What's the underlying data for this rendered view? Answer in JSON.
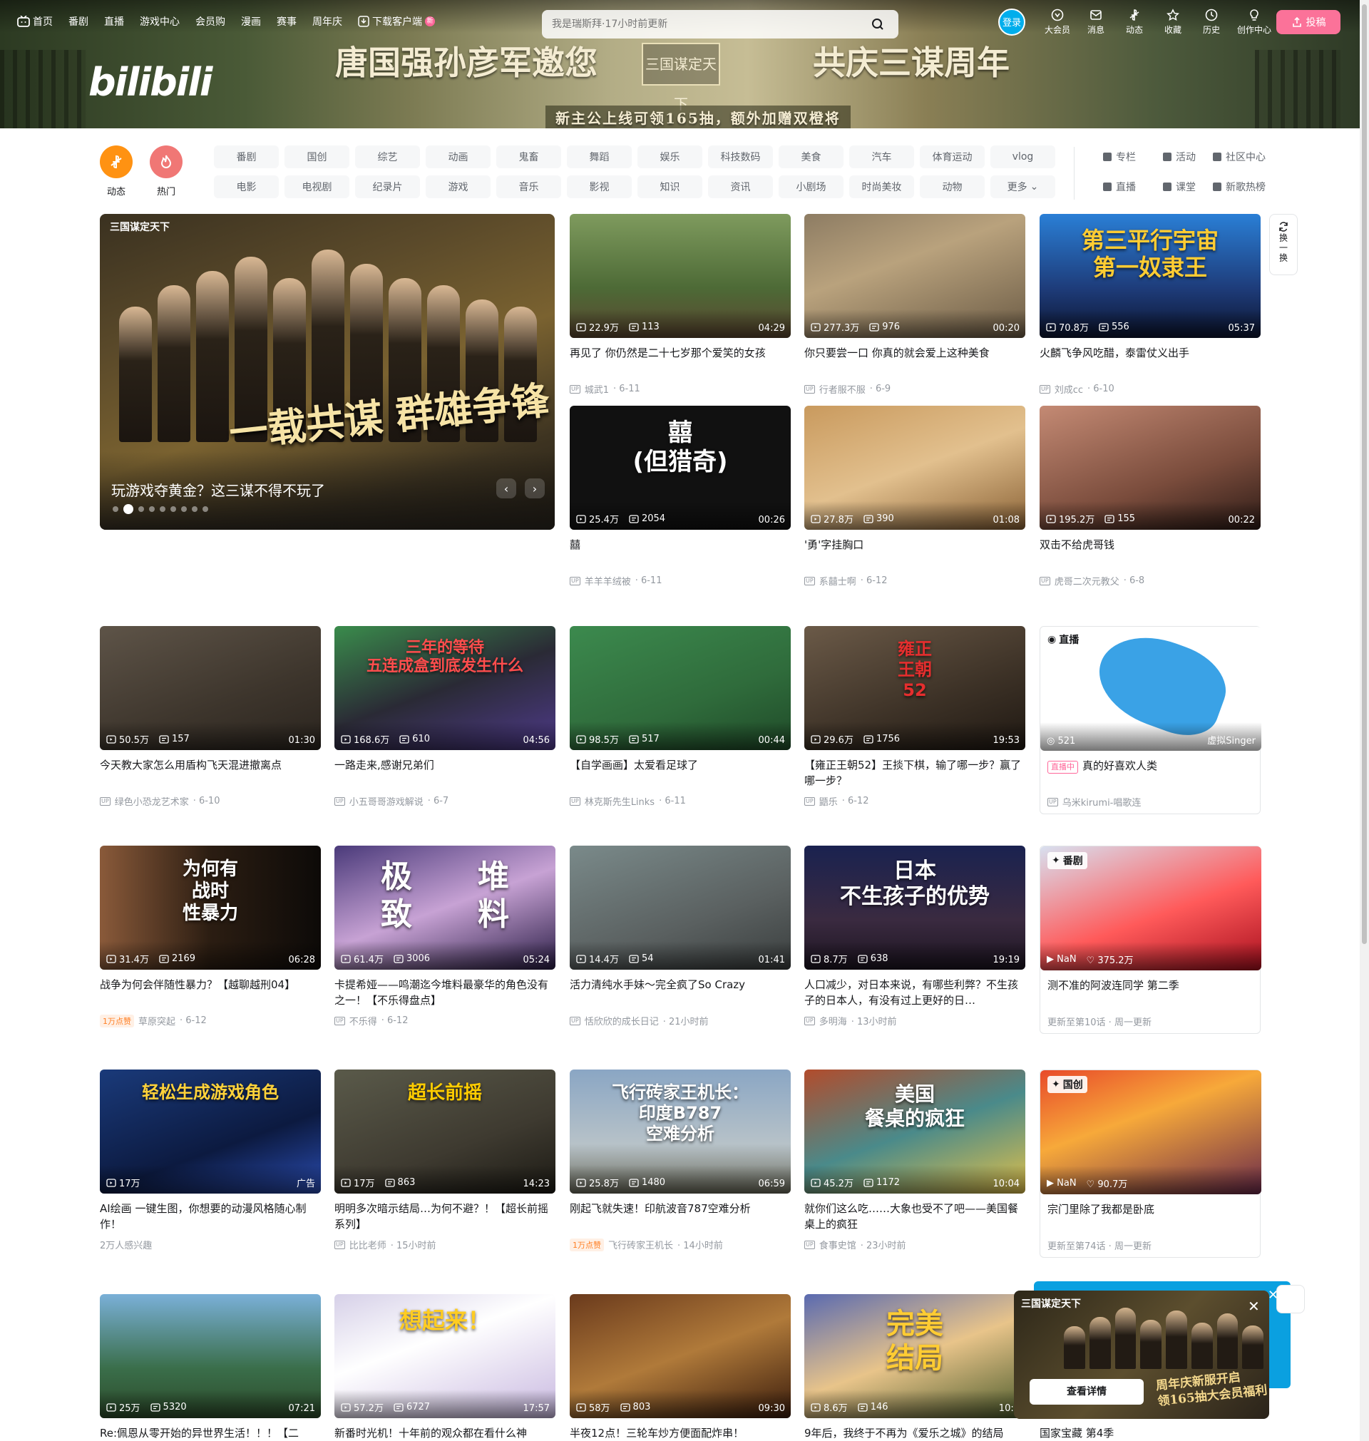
{
  "header": {
    "nav": [
      "首页",
      "番剧",
      "直播",
      "游戏中心",
      "会员购",
      "漫画",
      "赛事",
      "周年庆"
    ],
    "download": "下载客户端",
    "download_badge": "新",
    "search_placeholder": "我是瑞斯拜·17小时前更新",
    "login": "登录",
    "right": [
      "大会员",
      "消息",
      "动态",
      "收藏",
      "历史",
      "创作中心"
    ],
    "upload": "投稿",
    "logo": "bilibili",
    "banner_slogan_left": "唐国强孙彦军邀您",
    "banner_slogan_right": "共庆三谋周年",
    "banner_subline": "新主公上线可领165抽，额外加赠双橙将",
    "banner_game": "三国谋定天下"
  },
  "channels": {
    "big": [
      {
        "label": "动态",
        "color": "#ff9212"
      },
      {
        "label": "热门",
        "color": "#f07775"
      }
    ],
    "chips": [
      "番剧",
      "国创",
      "综艺",
      "动画",
      "鬼畜",
      "舞蹈",
      "娱乐",
      "科技数码",
      "美食",
      "汽车",
      "体育运动",
      "vlog",
      "电影",
      "电视剧",
      "纪录片",
      "游戏",
      "音乐",
      "影视",
      "知识",
      "资讯",
      "小剧场",
      "时尚美妆",
      "动物",
      "更多"
    ],
    "side": [
      "专栏",
      "活动",
      "社区中心",
      "直播",
      "课堂",
      "新歌热榜"
    ]
  },
  "carousel": {
    "title": "玩游戏夺黄金？这三谋不得不玩了",
    "tagline": "一载共谋 群雄争锋",
    "logo": "三国谋定天下",
    "dots": 9,
    "active_dot": 1
  },
  "refresh": "换一换",
  "videos": [
    {
      "title": "再见了 你仍然是二十七岁那个爱笑的女孩",
      "views": "22.9万",
      "danmaku": "113",
      "dur": "04:29",
      "up": "城武1",
      "date": "6-11",
      "bg": "linear-gradient(180deg,#7f9b5e,#4d6a36 60%,#5b4630)"
    },
    {
      "title": "你只要尝一口 你真的就会爱上这种美食",
      "views": "277.3万",
      "danmaku": "976",
      "dur": "00:20",
      "up": "行者服不服",
      "date": "6-9",
      "bg": "linear-gradient(160deg,#8d7c63,#b9a27d 40%,#6b5b45)"
    },
    {
      "title": "火麟飞争风吃醋，泰雷仗义出手",
      "views": "70.8万",
      "danmaku": "556",
      "dur": "05:37",
      "up": "刘成cc",
      "date": "6-10",
      "bg": "linear-gradient(180deg,#2a7fd6,#1e3c7a 60%,#0c1530)",
      "ov": "第三平行宇宙\n第一奴隶王",
      "ovc": "#ffcc33",
      "ovs": "32px"
    },
    {
      "title": "囍",
      "views": "25.4万",
      "danmaku": "2054",
      "dur": "00:26",
      "up": "羊羊羊绒被",
      "date": "6-11",
      "bg": "#111",
      "ov": "囍\n(但猎奇)",
      "ovc": "#fff",
      "ovs": "34px"
    },
    {
      "title": "'勇'字挂胸口",
      "views": "27.8万",
      "danmaku": "390",
      "dur": "01:08",
      "up": "系囍士啊",
      "date": "6-12",
      "bg": "linear-gradient(160deg,#c99a5e,#e2c08e 50%,#8a6236)"
    },
    {
      "title": "双击不给虎哥钱",
      "views": "195.2万",
      "danmaku": "155",
      "dur": "00:22",
      "up": "虎哥二次元教父",
      "date": "6-8",
      "bg": "linear-gradient(160deg,#c48a74,#7a4c3c 60%,#2d1b16)"
    },
    {
      "title": "今天教大家怎么用盾构飞天混进撤离点",
      "views": "50.5万",
      "danmaku": "157",
      "dur": "01:30",
      "up": "绿色小恐龙艺术家",
      "date": "6-10",
      "bg": "linear-gradient(160deg,#5e5448,#3d352c 60%,#2a241e)"
    },
    {
      "title": "一路走来,感谢兄弟们",
      "views": "168.6万",
      "danmaku": "610",
      "dur": "04:56",
      "up": "小五哥哥游戏解说",
      "date": "6-7",
      "bg": "linear-gradient(160deg,#3a8c4c,#2a2a35 50%,#4e3a8a)",
      "ov": "三年的等待\n五连成盒到底发生什么",
      "ovc": "#ff4d4d",
      "ovs": "22px"
    },
    {
      "title": "【自学画画】太爱看足球了",
      "views": "98.5万",
      "danmaku": "517",
      "dur": "00:44",
      "up": "林克斯先生Links",
      "date": "6-11",
      "bg": "linear-gradient(160deg,#3c8a4e,#2f6b3b 60%,#1f4a28)"
    },
    {
      "title": "【雍正王朝52】王掞下棋，输了哪一步？赢了哪一步？",
      "views": "29.6万",
      "danmaku": "1756",
      "dur": "19:53",
      "up": "鼯乐",
      "date": "6-12",
      "bg": "linear-gradient(160deg,#6b5a48,#3c3126 60%,#1f1812)",
      "ov": "雍正\n王朝\n52",
      "ovc": "#e52e2e",
      "ovs": "24px"
    },
    {
      "title": "战争为何会伴随性暴力？【越聊越刑04】",
      "views": "31.4万",
      "danmaku": "2169",
      "dur": "06:28",
      "up": "草原突起",
      "date": "6-12",
      "hot": "1万点赞",
      "bg": "linear-gradient(90deg,#8a5a3a,#2b1d12 50%,#0d0a08)",
      "ov": "为何有\n战时\n性暴力",
      "ovc": "#fff",
      "ovs": "26px"
    },
    {
      "title": "卡提希娅——鸣潮迄今堆料最豪华的角色没有之一！【不乐得盘点】",
      "views": "61.4万",
      "danmaku": "3006",
      "dur": "05:24",
      "up": "不乐得",
      "date": "6-12",
      "bg": "linear-gradient(160deg,#4a3a7a,#c7a2d4 50%,#2a1d46)",
      "ov": "极      堆\n致      料",
      "ovc": "#fff",
      "ovs": "44px"
    },
    {
      "title": "活力清纯水手妹～完全疯了So Crazy",
      "views": "14.4万",
      "danmaku": "54",
      "dur": "01:41",
      "up": "恬欣欣的成长日记",
      "date": "21小时前",
      "bg": "linear-gradient(160deg,#7a8a8a,#5a6060 60%,#3a3e3e)"
    },
    {
      "title": "人口减少，对日本来说，有哪些利弊？不生孩子的日本人，有没有过上更好的日…",
      "views": "8.7万",
      "danmaku": "638",
      "dur": "19:19",
      "up": "多明海",
      "date": "13小时前",
      "bg": "linear-gradient(180deg,#1a2250,#3a2a40 60%,#1c1420)",
      "ov": "日本\n不生孩子的优势",
      "ovc": "#ffffff",
      "ovs": "30px"
    },
    {
      "title": "AI绘画 一键生图，你想要的动漫风格随心制作！",
      "views": "17万",
      "danmaku": "",
      "dur": "",
      "up": "2万人感兴趣",
      "date": "",
      "ad": "广告",
      "bg": "linear-gradient(160deg,#1a3a7a,#0c1a40 60%,#2a4cb0)",
      "ov": "轻松生成游戏角色",
      "ovc": "#ffd23a",
      "ovs": "24px"
    },
    {
      "title": "明明多次暗示结局…为何不避？！【超长前摇系列】",
      "views": "17万",
      "danmaku": "863",
      "dur": "14:23",
      "up": "比比老师",
      "date": "15小时前",
      "bg": "linear-gradient(160deg,#5a5a4a,#3e3a30 60%,#1c1a14)",
      "ov": "超长前摇",
      "ovc": "#ffcc00",
      "ovs": "26px"
    },
    {
      "title": "刚起飞就失速！印航波音787空难分析",
      "views": "25.8万",
      "danmaku": "1480",
      "dur": "06:59",
      "up": "飞行砖家王机长",
      "date": "14小时前",
      "hot": "1万点赞",
      "bg": "linear-gradient(180deg,#8aa6c4,#b7c2c8 60%,#6a6a5a)",
      "ov": "飞行砖家王机长：\n印度B787\n空难分析",
      "ovc": "#ffffff",
      "ovs": "24px"
    },
    {
      "title": "就你们这么吃……大象也受不了吧——美国餐桌上的疯狂",
      "views": "45.2万",
      "danmaku": "1172",
      "dur": "10:04",
      "up": "食事史馆",
      "date": "23小时前",
      "bg": "linear-gradient(160deg,#b24c2c,#4a8a8a 50%,#e0c04a)",
      "ov": "美国\n餐桌的疯狂",
      "ovc": "#ffffff",
      "ovs": "28px"
    },
    {
      "title": "Re:佩恩从零开始的异世界生活！！！【二",
      "views": "25万",
      "danmaku": "5320",
      "dur": "07:21",
      "up": "",
      "date": "",
      "bg": "linear-gradient(180deg,#7ab0d8,#3a6e4a 60%,#2c4a2a)"
    },
    {
      "title": "新番时光机！十年前的观众都在看什么神",
      "views": "57.2万",
      "danmaku": "6727",
      "dur": "17:57",
      "up": "",
      "date": "",
      "bg": "linear-gradient(160deg,#d6d0e8,#ffffff 40%,#c8b8e0)",
      "ov": "想起来！",
      "ovc": "#ffcc22",
      "ovs": "32px"
    },
    {
      "title": "半夜12点！三轮车炒方便面配炸串！",
      "views": "58万",
      "danmaku": "803",
      "dur": "09:30",
      "up": "",
      "date": "",
      "bg": "linear-gradient(160deg,#6a3a1c,#b07a3a 50%,#3a1c0c)"
    },
    {
      "title": "9年后，我终于不再为《爱乐之城》的结局",
      "views": "8.6万",
      "danmaku": "146",
      "dur": "10:2",
      "up": "",
      "date": "",
      "bg": "linear-gradient(160deg,#5a6ab0,#e8c48a 50%,#4a5a2a)",
      "ov": "完美\n结局",
      "ovc": "#ffcc33",
      "ovs": "40px"
    }
  ],
  "special": {
    "live": {
      "tag": "直播",
      "title": "真的好喜欢人类",
      "badge": "直播中",
      "viewers": "521",
      "host": "虚拟Singer",
      "up": "乌米kirumi-唱歌连"
    },
    "bangumi": {
      "tag": "番剧",
      "title": "测不准的阿波连同学 第二季",
      "views": "NaN",
      "likes": "375.2万",
      "update": "更新至第10话 · 周一更新"
    },
    "guochuang": {
      "tag": "国创",
      "title": "宗门里除了我都是卧底",
      "views": "NaN",
      "likes": "90.7万",
      "update": "更新至第74话 · 周一更新"
    },
    "bottom5": {
      "title": "国家宝藏 第4季"
    }
  },
  "popup": {
    "button": "查看详情",
    "text": "周年庆新服开启\n领165抽大会员福利",
    "logo": "三国谋定天下"
  }
}
